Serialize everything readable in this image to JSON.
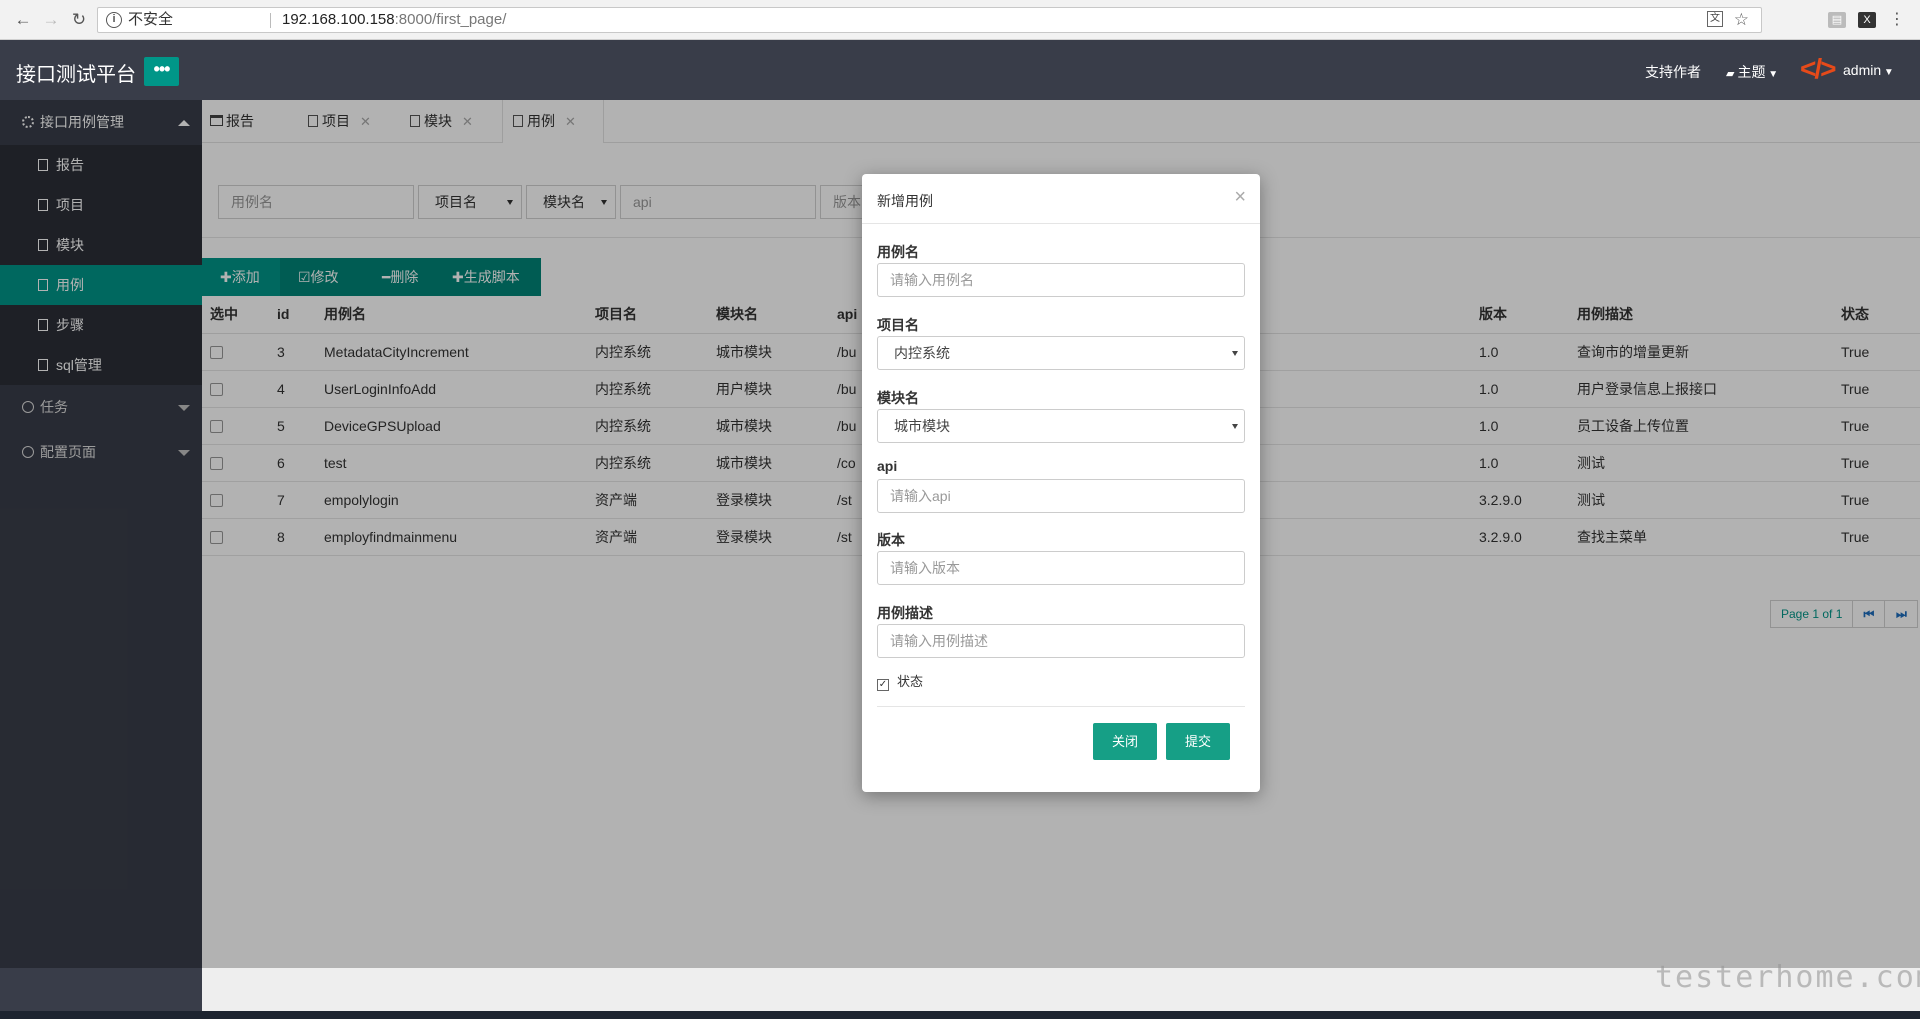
{
  "browser": {
    "insecure_label": "不安全",
    "url_host": "192.168.100.158",
    "url_path": ":8000/first_page/"
  },
  "header": {
    "brand": "接口测试平台",
    "menu_toggle": "•••",
    "support_author": "支持作者",
    "theme": "主题",
    "user": "admin"
  },
  "sidebar": {
    "group_main": "接口用例管理",
    "items": [
      {
        "label": "报告"
      },
      {
        "label": "项目"
      },
      {
        "label": "模块"
      },
      {
        "label": "用例"
      },
      {
        "label": "步骤"
      },
      {
        "label": "sql管理"
      }
    ],
    "group_tasks": "任务",
    "group_config": "配置页面"
  },
  "tabs": [
    {
      "label": "报告"
    },
    {
      "label": "项目"
    },
    {
      "label": "模块"
    },
    {
      "label": "用例"
    }
  ],
  "search": {
    "case_name_placeholder": "用例名",
    "project_select": "项目名",
    "module_select": "模块名",
    "api_placeholder": "api",
    "version_placeholder": "版本"
  },
  "toolbar": {
    "add": "✚添加",
    "edit": "☑修改",
    "delete": "━删除",
    "gen_script": "✚生成脚本"
  },
  "table": {
    "headers": [
      "选中",
      "id",
      "用例名",
      "项目名",
      "模块名",
      "api",
      "版本",
      "用例描述",
      "状态"
    ],
    "rows": [
      {
        "id": "3",
        "name": "MetadataCityIncrement",
        "project": "内控系统",
        "module": "城市模块",
        "api": "/bu",
        "version": "1.0",
        "desc": "查询市的增量更新",
        "status": "True"
      },
      {
        "id": "4",
        "name": "UserLoginInfoAdd",
        "project": "内控系统",
        "module": "用户模块",
        "api": "/bu",
        "version": "1.0",
        "desc": "用户登录信息上报接口",
        "status": "True"
      },
      {
        "id": "5",
        "name": "DeviceGPSUpload",
        "project": "内控系统",
        "module": "城市模块",
        "api": "/bu",
        "version": "1.0",
        "desc": "员工设备上传位置",
        "status": "True"
      },
      {
        "id": "6",
        "name": "test",
        "project": "内控系统",
        "module": "城市模块",
        "api": "/co",
        "version": "1.0",
        "desc": "测试",
        "status": "True"
      },
      {
        "id": "7",
        "name": "empolylogin",
        "project": "资产端",
        "module": "登录模块",
        "api": "/st",
        "version": "3.2.9.0",
        "desc": "测试",
        "status": "True"
      },
      {
        "id": "8",
        "name": "employfindmainmenu",
        "project": "资产端",
        "module": "登录模块",
        "api": "/st",
        "version": "3.2.9.0",
        "desc": "查找主菜单",
        "status": "True"
      }
    ]
  },
  "pager": {
    "info": "Page 1 of 1",
    "first": "⏮",
    "last": "⏭"
  },
  "modal": {
    "title": "新增用例",
    "close": "×",
    "case_name_label": "用例名",
    "case_name_placeholder": "请输入用例名",
    "project_label": "项目名",
    "project_value": "内控系统",
    "module_label": "模块名",
    "module_value": "城市模块",
    "api_label": "api",
    "api_placeholder": "请输入api",
    "version_label": "版本",
    "version_placeholder": "请输入版本",
    "desc_label": "用例描述",
    "desc_placeholder": "请输入用例描述",
    "status_label": "状态",
    "status_checked": true,
    "btn_close": "关闭",
    "btn_submit": "提交"
  },
  "watermark": "testerhome.com",
  "colors": {
    "accent": "#009688",
    "header_bg": "#393d49",
    "sidebar_sub_bg": "#2b2e37",
    "logo": "#e64a19"
  }
}
